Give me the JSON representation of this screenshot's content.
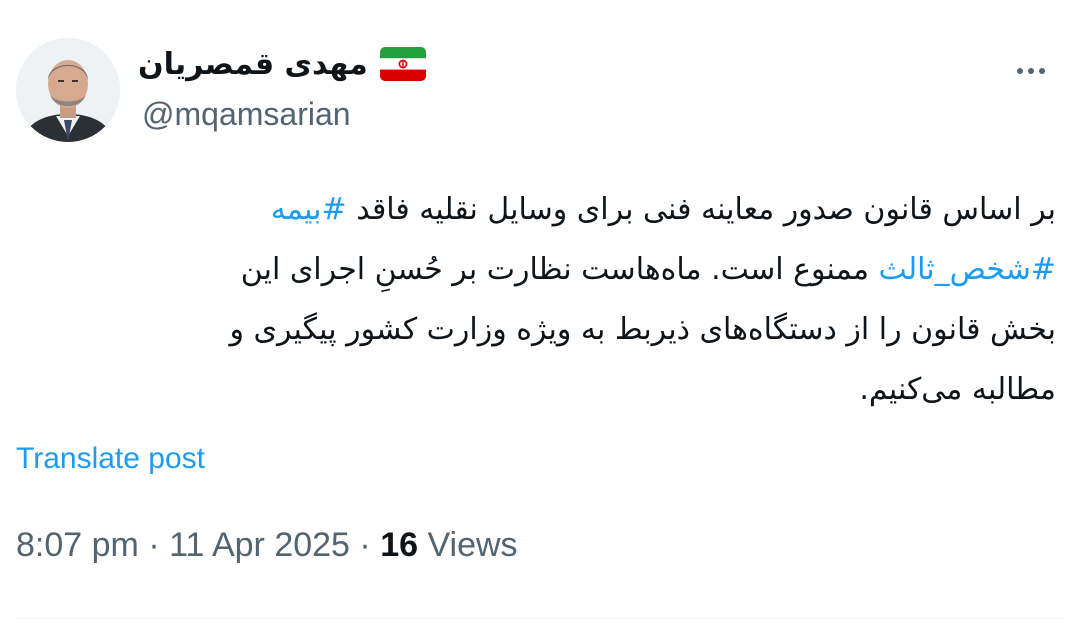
{
  "author": {
    "display_name": "مهدی قمصریان",
    "handle": "@mqamsarian",
    "flag_icon": "iran-flag-icon"
  },
  "menu": {
    "icon": "more-options-icon"
  },
  "post": {
    "lines": [
      {
        "pre": "بر اساس قانون صدور معاینه فنی برای وسایل نقلیه فاقد ",
        "hashtag": "#بیمه"
      },
      {
        "hashtag": "#شخص_ثالث",
        "post": " ممنوع است. ماه‌هاست نظارت بر حُسنِ اجرای این"
      },
      {
        "text": "بخش قانون را از دستگاه‌های ذیربط  به ویژه وزارت کشور پیگیری و"
      },
      {
        "text": "مطالبه می‌کنیم."
      }
    ]
  },
  "translate_label": "Translate post",
  "meta": {
    "time": "8:07 pm",
    "separator": "·",
    "date": "11 Apr 2025",
    "views_count": "16",
    "views_label": "Views"
  },
  "colors": {
    "text": "#0f1419",
    "secondary": "#536471",
    "link": "#1d9bf0"
  }
}
